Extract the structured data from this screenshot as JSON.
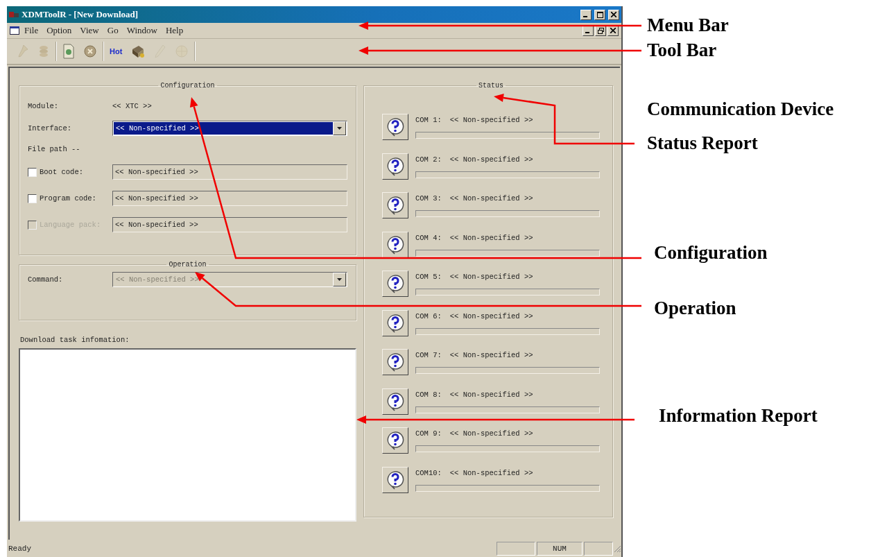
{
  "window": {
    "title": "XDMToolR - [New Download]"
  },
  "menu": [
    {
      "label": "File"
    },
    {
      "label": "Option"
    },
    {
      "label": "View"
    },
    {
      "label": "Go"
    },
    {
      "label": "Window"
    },
    {
      "label": "Help"
    }
  ],
  "toolbar": [
    {
      "kind": "pin",
      "disabled": true
    },
    {
      "kind": "coins",
      "disabled": true
    },
    {
      "kind": "page",
      "disabled": false
    },
    {
      "kind": "stop",
      "disabled": false
    },
    {
      "kind": "text",
      "label": "Hot",
      "disabled": false
    },
    {
      "kind": "chip",
      "disabled": false
    },
    {
      "kind": "pencil",
      "disabled": true
    },
    {
      "kind": "globe",
      "disabled": true
    }
  ],
  "configuration": {
    "title": "Configuration",
    "module_label": "Module:",
    "module_value": "<< XTC >>",
    "interface_label": "Interface:",
    "interface_value": "<< Non-specified >>",
    "interface_focused": true,
    "file_path_label": "File path --",
    "files": [
      {
        "label": "Boot code:",
        "checked": false,
        "disabled": false,
        "value": "<< Non-specified >>"
      },
      {
        "label": "Program code:",
        "checked": false,
        "disabled": false,
        "value": "<< Non-specified >>"
      },
      {
        "label": "Language pack:",
        "checked": false,
        "disabled": true,
        "value": "<< Non-specified >>"
      }
    ]
  },
  "operation": {
    "title": "Operation",
    "command_label": "Command:",
    "command_value": "<< Non-specified >>",
    "disabled": true
  },
  "information": {
    "label": "Download task infomation:"
  },
  "status": {
    "title": "Status",
    "ports": [
      {
        "label": "COM 1:",
        "value": "<< Non-specified >>",
        "level": 0
      },
      {
        "label": "COM 2:",
        "value": "<< Non-specified >>",
        "level": 0
      },
      {
        "label": "COM 3:",
        "value": "<< Non-specified >>",
        "level": 0
      },
      {
        "label": "COM 4:",
        "value": "<< Non-specified >>",
        "level": 0
      },
      {
        "label": "COM 5:",
        "value": "<< Non-specified >>",
        "level": 0
      },
      {
        "label": "COM 6:",
        "value": "<< Non-specified >>",
        "level": 0
      },
      {
        "label": "COM 7:",
        "value": "<< Non-specified >>",
        "level": 0
      },
      {
        "label": "COM 8:",
        "value": "<< Non-specified >>",
        "level": 0
      },
      {
        "label": "COM 9:",
        "value": "<< Non-specified >>",
        "level": 0
      },
      {
        "label": "COM10:",
        "value": "<< Non-specified >>",
        "level": 0
      }
    ]
  },
  "status_bar": {
    "message": "Ready",
    "indicators": [
      "NUM"
    ]
  },
  "annotations": [
    {
      "label": "Menu Bar"
    },
    {
      "label": "Tool Bar"
    },
    {
      "label": "Communication Device"
    },
    {
      "label": "Status Report"
    },
    {
      "label": "Configuration"
    },
    {
      "label": "Operation"
    },
    {
      "label": "Information Report"
    }
  ]
}
